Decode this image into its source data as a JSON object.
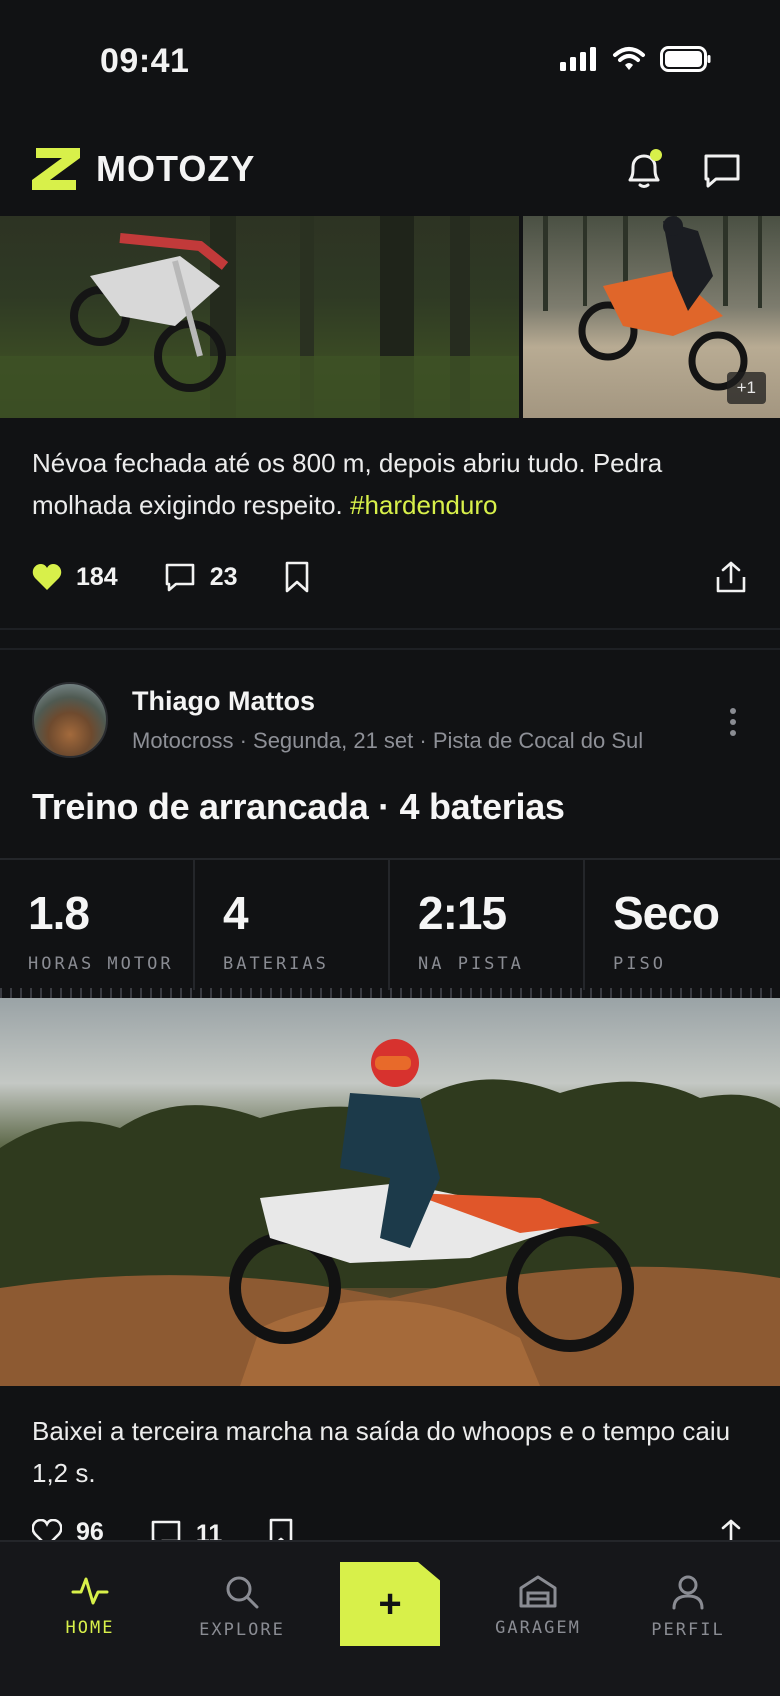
{
  "status_bar": {
    "time": "09:41"
  },
  "header": {
    "brand": "MOTOZY",
    "accent": "#d8f04a"
  },
  "post1": {
    "more_photos": "+1",
    "caption_text": "Névoa fechada até os 800 m, depois abriu tudo. Pedra molhada exigindo respeito. ",
    "hashtag": "#hardenduro",
    "likes": "184",
    "comments": "23"
  },
  "post2": {
    "author": "Thiago Mattos",
    "meta": "Motocross · Segunda, 21 set · Pista de Cocal do Sul",
    "title": "Treino de arrancada · 4 baterias",
    "stats": [
      {
        "value": "1.8",
        "label": "HORAS MOTOR"
      },
      {
        "value": "4",
        "label": "BATERIAS"
      },
      {
        "value": "2:15",
        "label": "NA PISTA"
      },
      {
        "value": "Seco",
        "label": "PISO"
      }
    ],
    "caption": "Baixei a terceira marcha na saída do whoops e o tempo caiu 1,2 s.",
    "likes": "96",
    "comments": "11"
  },
  "nav": {
    "home": "HOME",
    "explore": "EXPLORE",
    "create": "+",
    "garage": "GARAGEM",
    "profile": "PERFIL"
  }
}
